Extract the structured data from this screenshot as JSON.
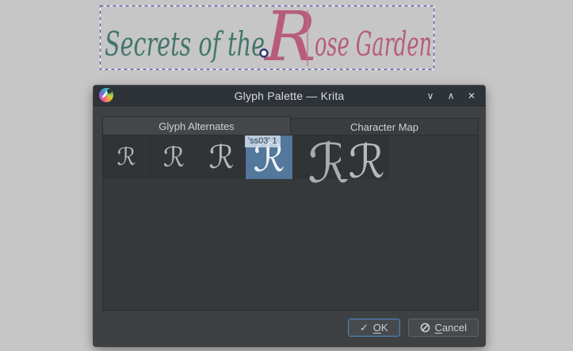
{
  "canvas": {
    "artwork_text": {
      "segment1": "Secrets of the",
      "segment1_color": "#43766a",
      "segment2_initial": "R",
      "segment2_rest": "ose Garden",
      "segment2_color": "#b75c7c"
    },
    "selection_color": "#585fa9"
  },
  "dialog": {
    "title": "Glyph Palette — Krita",
    "window_controls": {
      "minimize": "∨",
      "maximize": "∧",
      "close": "✕"
    },
    "tabs": [
      {
        "label": "Glyph Alternates",
        "active": true
      },
      {
        "label": "Character Map",
        "active": false
      }
    ],
    "glyph_palette": {
      "base_character": "R",
      "selected_index": 3,
      "tooltip": "'ss03' 1",
      "cells": [
        {
          "glyph": "ℛ"
        },
        {
          "glyph": "ℛ"
        },
        {
          "glyph": "ℛ"
        },
        {
          "glyph": "ℛ"
        },
        {
          "glyph": "ℛ"
        },
        {
          "glyph": "ℛ"
        }
      ],
      "selected_color": "#54779c"
    },
    "footer": {
      "ok_icon": "✓",
      "ok_mnemonic": "O",
      "ok_rest": "K",
      "cancel_mnemonic": "C",
      "cancel_rest": "ancel"
    }
  }
}
